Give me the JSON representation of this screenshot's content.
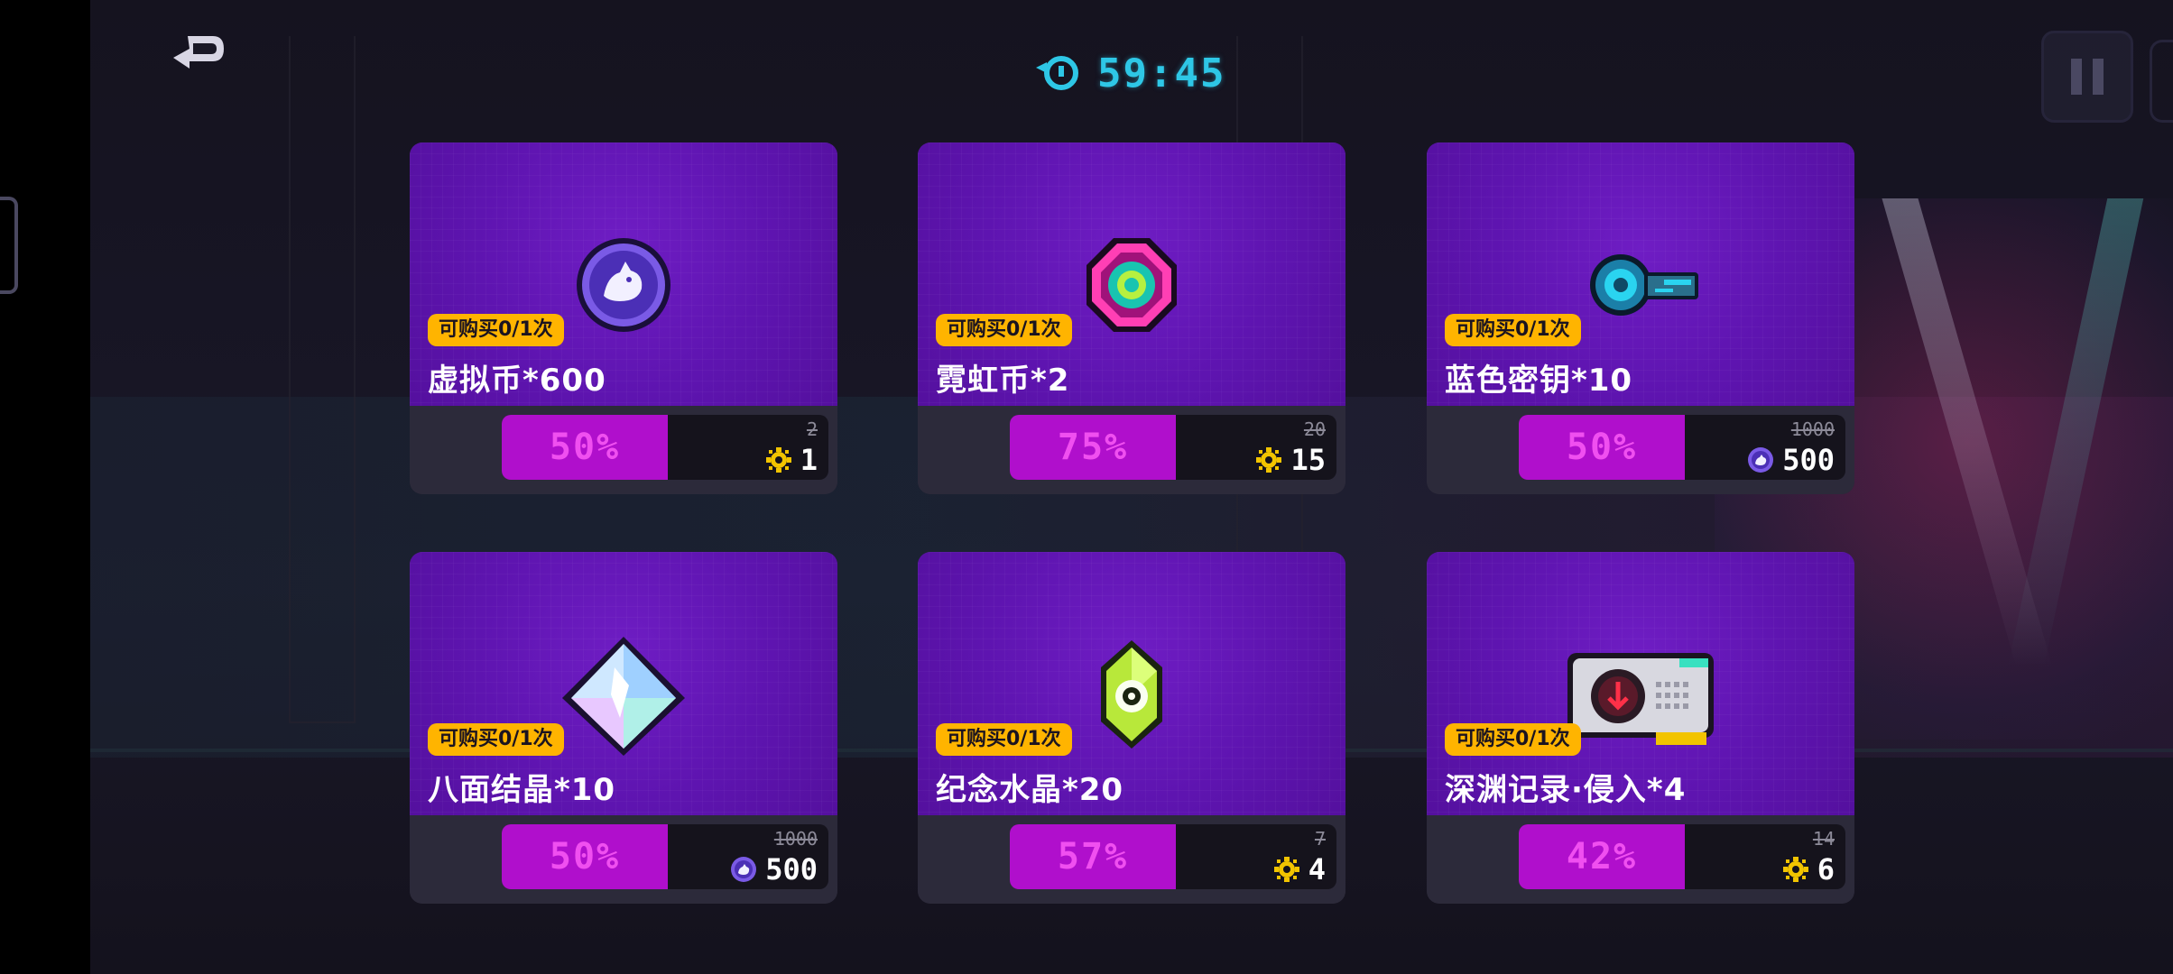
{
  "timer": {
    "value": "59:45"
  },
  "shop": {
    "cards": [
      {
        "limit": "可购买0/1次",
        "name": "虚拟币*600",
        "discount": "50%",
        "old_price": "2",
        "new_price": "1",
        "currency": "gold-gear-icon",
        "art": "virtual-coin-icon"
      },
      {
        "limit": "可购买0/1次",
        "name": "霓虹币*2",
        "discount": "75%",
        "old_price": "20",
        "new_price": "15",
        "currency": "gold-gear-icon",
        "art": "neon-coin-icon"
      },
      {
        "limit": "可购买0/1次",
        "name": "蓝色密钥*10",
        "discount": "50%",
        "old_price": "1000",
        "new_price": "500",
        "currency": "virtual-coin-icon",
        "art": "blue-key-icon"
      },
      {
        "limit": "可购买0/1次",
        "name": "八面结晶*10",
        "discount": "50%",
        "old_price": "1000",
        "new_price": "500",
        "currency": "virtual-coin-icon",
        "art": "octahedral-crystal-icon"
      },
      {
        "limit": "可购买0/1次",
        "name": "纪念水晶*20",
        "discount": "57%",
        "old_price": "7",
        "new_price": "4",
        "currency": "gold-gear-icon",
        "art": "memorial-crystal-icon"
      },
      {
        "limit": "可购买0/1次",
        "name": "深渊记录·侵入*4",
        "discount": "42%",
        "old_price": "14",
        "new_price": "6",
        "currency": "gold-gear-icon",
        "art": "abyss-record-chip-icon"
      }
    ]
  },
  "colors": {
    "accent_cyan": "#2ec7e6",
    "card_purple": "#5e14b0",
    "discount_magenta": "#b00fcc",
    "badge_yellow": "#ffb400"
  }
}
